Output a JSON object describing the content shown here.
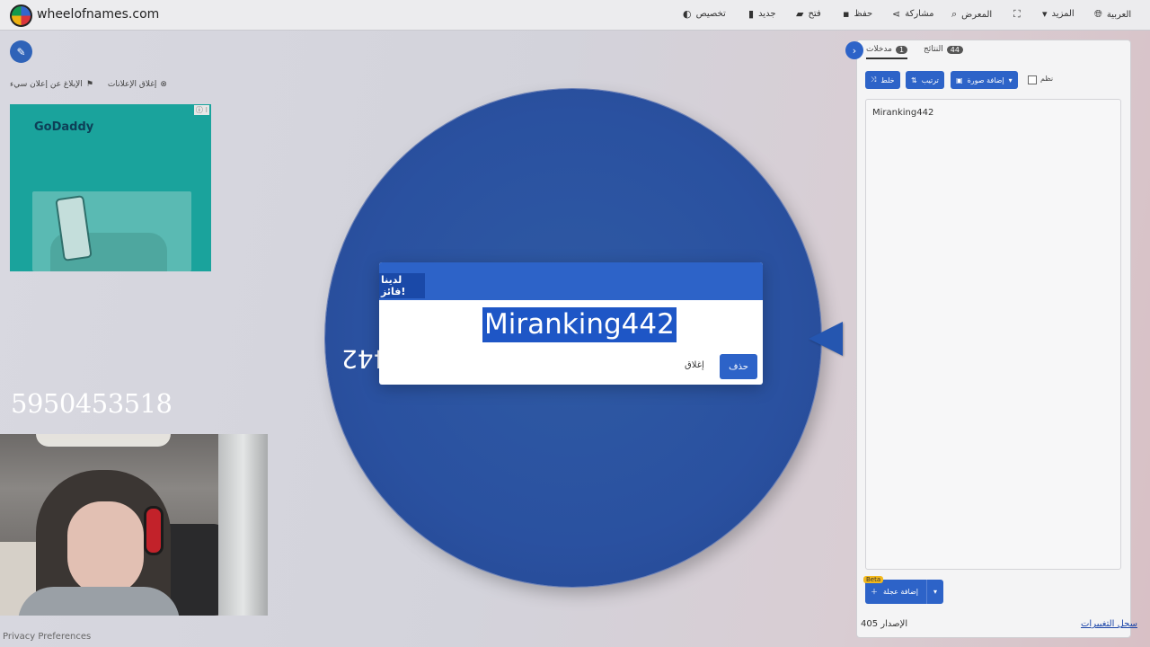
{
  "header": {
    "brand": "wheelofnames.com",
    "nav": [
      {
        "label": "العربية",
        "icon": "globe-icon"
      },
      {
        "label": "المزيد",
        "icon": "caret-down-icon"
      },
      {
        "label": "",
        "icon": "fullscreen-icon"
      },
      {
        "label": "المعرض",
        "icon": "search-icon"
      },
      {
        "label": "مشاركة",
        "icon": "share-icon"
      },
      {
        "label": "حفظ",
        "icon": "save-icon"
      },
      {
        "label": "فتح",
        "icon": "folder-icon"
      },
      {
        "label": "جديد",
        "icon": "file-icon"
      },
      {
        "label": "تخصيص",
        "icon": "palette-icon"
      }
    ]
  },
  "left": {
    "report_ad": "الإبلاغ عن إعلان سيء",
    "close_ads": "إغلاق الإعلانات",
    "ad_brand": "GoDaddy",
    "big_number": "5950453518",
    "privacy": "Privacy Preferences"
  },
  "wheel": {
    "segment_text": "442",
    "color": "#2a51a0"
  },
  "modal": {
    "title": "لدينا فائز!",
    "winner": "Miranking442",
    "close_label": "إغلاق",
    "remove_label": "حذف"
  },
  "panel": {
    "tabs": [
      {
        "label": "مدخلات",
        "count": "1"
      },
      {
        "label": "النتائج",
        "count": "44"
      }
    ],
    "toolbar": {
      "shuffle": "خلط",
      "sort": "ترتيب",
      "add_image": "إضافة صورة",
      "advanced": "نظم"
    },
    "entries": [
      "Miranking442"
    ],
    "add_wheel": "إضافة عجلة",
    "beta": "Beta",
    "version": "الإصدار 405",
    "changelog": "سجل التغييرات"
  },
  "colors": {
    "accent": "#2d63c8",
    "topbar": "#ececee"
  }
}
